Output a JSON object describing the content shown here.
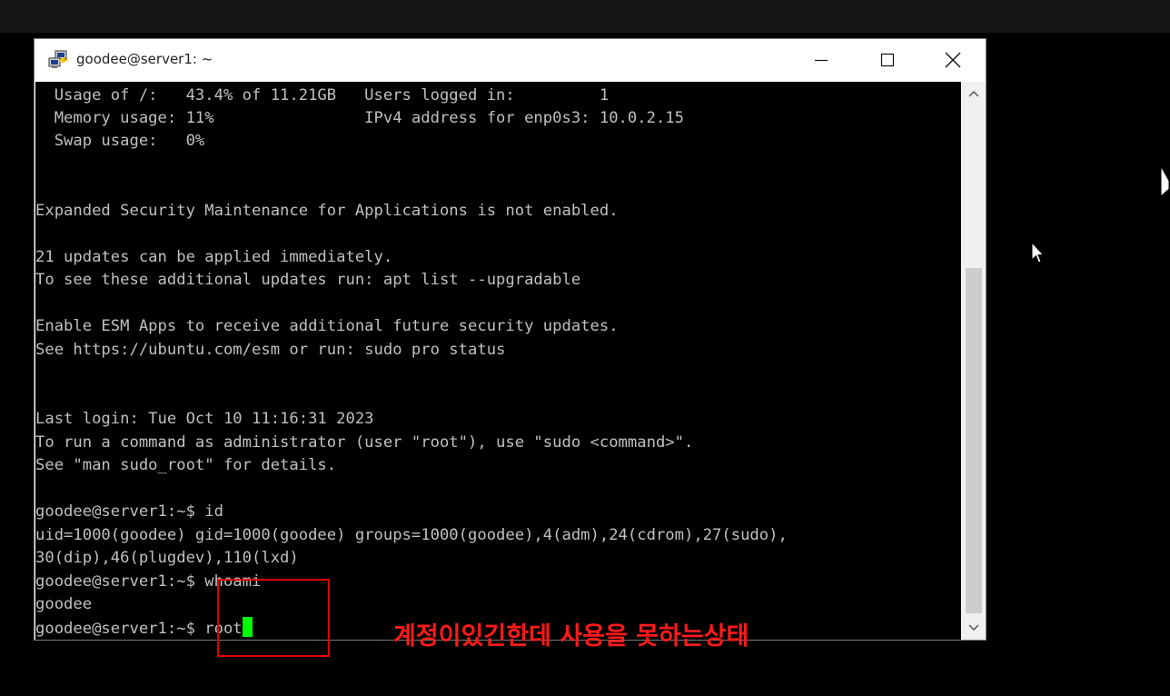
{
  "window": {
    "title": "goodee@server1: ~"
  },
  "terminal": {
    "lines": [
      "  Usage of /:   43.4% of 11.21GB   Users logged in:         1",
      "  Memory usage: 11%                IPv4 address for enp0s3: 10.0.2.15",
      "  Swap usage:   0%",
      "",
      "",
      "Expanded Security Maintenance for Applications is not enabled.",
      "",
      "21 updates can be applied immediately.",
      "To see these additional updates run: apt list --upgradable",
      "",
      "Enable ESM Apps to receive additional future security updates.",
      "See https://ubuntu.com/esm or run: sudo pro status",
      "",
      "",
      "Last login: Tue Oct 10 11:16:31 2023",
      "To run a command as administrator (user \"root\"), use \"sudo <command>\".",
      "See \"man sudo_root\" for details.",
      "",
      "goodee@server1:~$ id",
      "uid=1000(goodee) gid=1000(goodee) groups=1000(goodee),4(adm),24(cdrom),27(sudo),",
      "30(dip),46(plugdev),110(lxd)",
      "goodee@server1:~$ whoami",
      "goodee"
    ],
    "prompt_line": "goodee@server1:~$ root"
  },
  "annotation": {
    "text": "계정이있긴한데 사용을 못하는상태",
    "color": "#ff1a1a"
  },
  "icons": {
    "app": "putty-icon",
    "minimize": "minimize-icon",
    "maximize": "maximize-icon",
    "close": "close-icon"
  }
}
